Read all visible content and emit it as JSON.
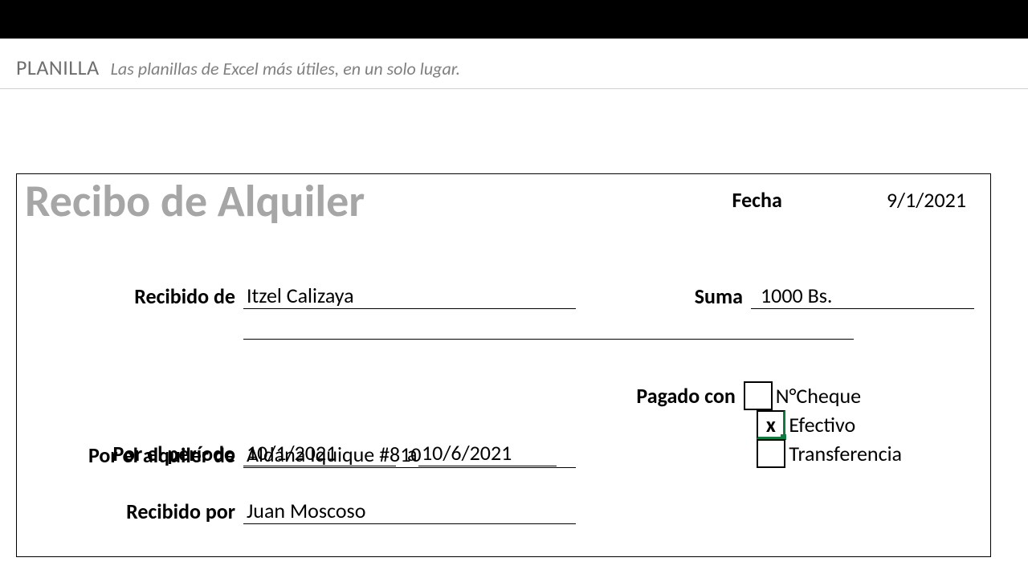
{
  "header": {
    "brand": "PLANILLA",
    "tagline": "Las planillas de Excel más útiles, en un solo lugar."
  },
  "receipt": {
    "title": "Recibo de Alquiler",
    "date_label": "Fecha",
    "date_value": "9/1/2021",
    "received_from_label": "Recibido de",
    "received_from_value": "Itzel Calizaya",
    "sum_label": "Suma",
    "sum_value": "1000 Bs.",
    "rent_of_label": "Por el alquiler de",
    "rent_of_value": "Aldana Iquique #810",
    "period_label": "Por el período",
    "period_from": "10/1/2021",
    "period_sep": "a",
    "period_to": "10/6/2021",
    "received_by_label": "Recibido por",
    "received_by_value": "Juan Moscoso",
    "paid_with_label": "Pagado con",
    "options": {
      "cheque": {
        "mark": "",
        "label": "N°Cheque"
      },
      "efectivo": {
        "mark": "x",
        "label": "Efectivo"
      },
      "transferencia": {
        "mark": "",
        "label": "Transferencia"
      }
    }
  }
}
